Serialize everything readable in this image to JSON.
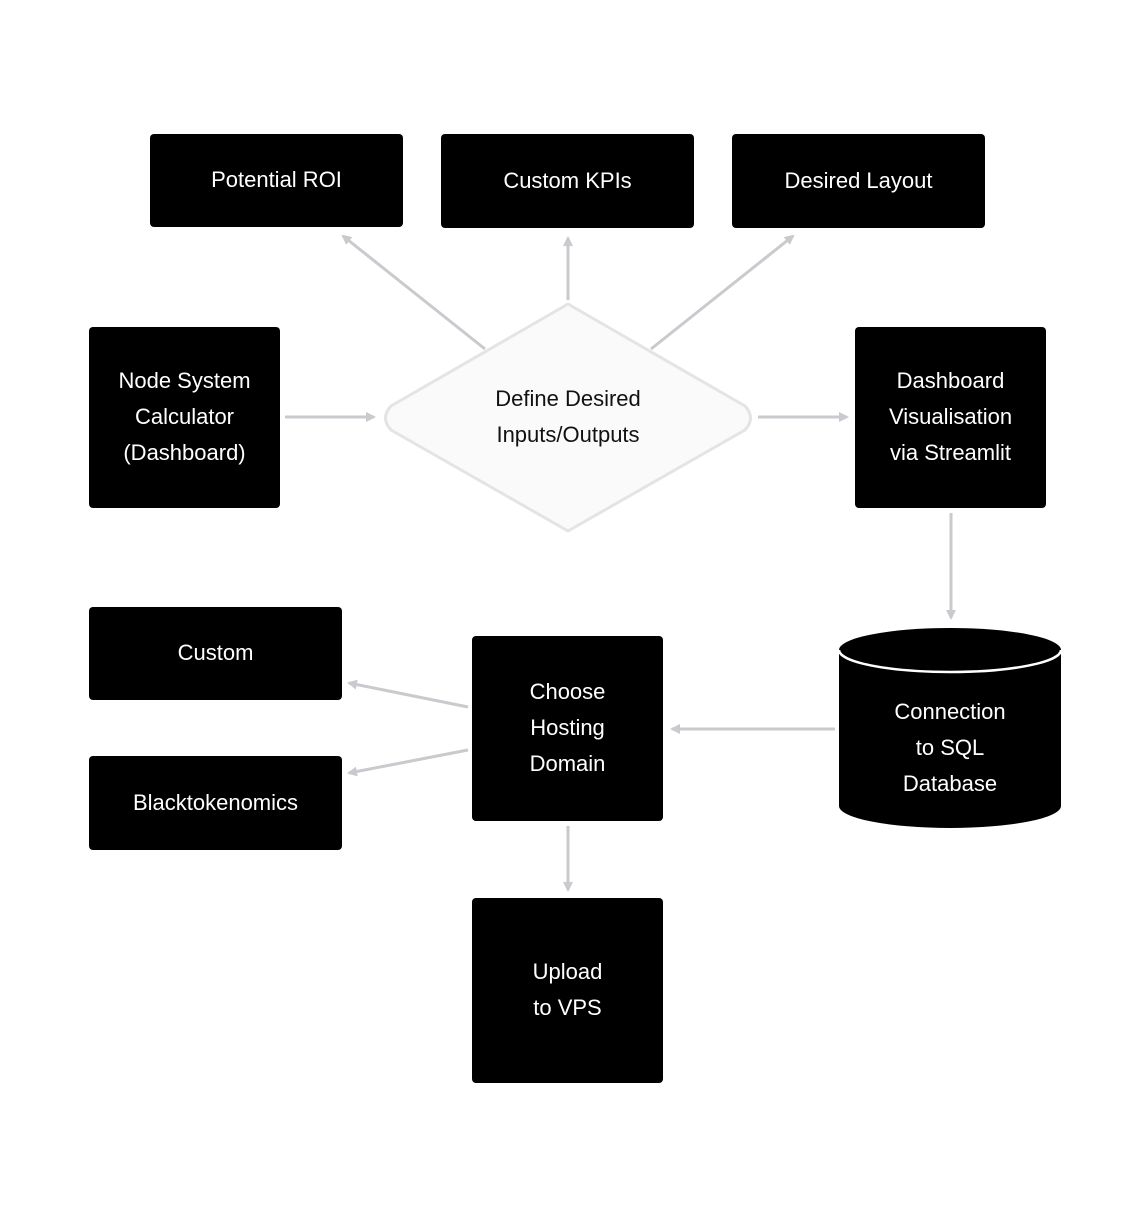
{
  "diagram": {
    "colors": {
      "box_fill": "#000000",
      "box_text": "#ffffff",
      "decision_fill": "#fafafa",
      "decision_stroke": "#e4e4e7",
      "decision_text": "#111111",
      "edge": "#c9c9ce"
    },
    "nodes": {
      "potential_roi": {
        "lines": [
          "Potential ROI"
        ]
      },
      "custom_kpis": {
        "lines": [
          "Custom KPIs"
        ]
      },
      "desired_layout": {
        "lines": [
          "Desired Layout"
        ]
      },
      "node_calc": {
        "lines": [
          "Node System",
          "Calculator",
          "(Dashboard)"
        ]
      },
      "define": {
        "lines": [
          "Define Desired",
          "Inputs/Outputs"
        ]
      },
      "dashboard_vis": {
        "lines": [
          "Dashboard",
          "Visualisation",
          "via Streamlit"
        ]
      },
      "sql_db": {
        "lines": [
          "Connection",
          "to SQL",
          "Database"
        ]
      },
      "choose_hosting": {
        "lines": [
          "Choose",
          "Hosting",
          "Domain"
        ]
      },
      "custom": {
        "lines": [
          "Custom"
        ]
      },
      "blacktokenomics": {
        "lines": [
          "Blacktokenomics"
        ]
      },
      "upload_vps": {
        "lines": [
          "Upload",
          "to VPS"
        ]
      }
    },
    "edges": [
      {
        "from": "define",
        "to": "potential_roi"
      },
      {
        "from": "define",
        "to": "custom_kpis"
      },
      {
        "from": "define",
        "to": "desired_layout"
      },
      {
        "from": "node_calc",
        "to": "define"
      },
      {
        "from": "define",
        "to": "dashboard_vis"
      },
      {
        "from": "dashboard_vis",
        "to": "sql_db"
      },
      {
        "from": "sql_db",
        "to": "choose_hosting"
      },
      {
        "from": "choose_hosting",
        "to": "custom"
      },
      {
        "from": "choose_hosting",
        "to": "blacktokenomics"
      },
      {
        "from": "choose_hosting",
        "to": "upload_vps"
      }
    ]
  }
}
